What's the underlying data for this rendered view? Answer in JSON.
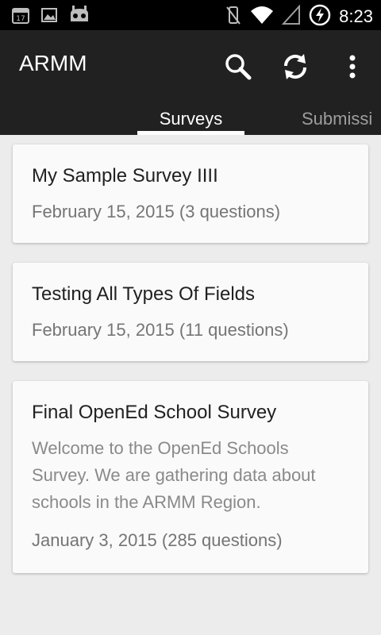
{
  "status_bar": {
    "time": "8:23",
    "left_icons": [
      "calendar-icon",
      "image-icon",
      "cyanogenmod-icon"
    ],
    "right_icons": [
      "mute-vibrate-icon",
      "wifi-icon",
      "signal-icon",
      "battery-charging-icon"
    ]
  },
  "app_bar": {
    "title": "ARMM",
    "actions": [
      "search-icon",
      "refresh-icon",
      "overflow-menu-icon"
    ],
    "calendar_day": "17"
  },
  "tabs": [
    {
      "label": "Surveys",
      "selected": true
    },
    {
      "label": "Submissi",
      "selected": false
    }
  ],
  "surveys": [
    {
      "title": "My Sample Survey IIII",
      "description": "",
      "meta": "February 15, 2015 (3 questions)"
    },
    {
      "title": "Testing All Types Of Fields",
      "description": "",
      "meta": "February 15, 2015 (11 questions)"
    },
    {
      "title": "Final OpenEd School Survey",
      "description": "Welcome to the OpenEd Schools Survey. We are gathering data about schools in the ARMM Region.",
      "meta": "January 3, 2015 (285 questions)"
    }
  ],
  "colors": {
    "status_bar": "#000000",
    "app_bar": "#212121",
    "background": "#ececec",
    "card": "#fafafa",
    "tab_inactive": "#9e9e9e"
  }
}
